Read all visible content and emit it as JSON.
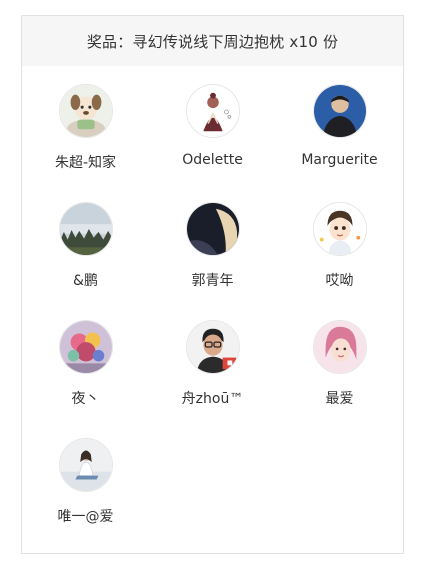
{
  "prize": {
    "label": "奖品：寻幻传说线下周边抱枕 x10 份"
  },
  "winners": [
    {
      "name": "朱超-知家",
      "avatar": "cartoon-dog-avatar"
    },
    {
      "name": "Odelette",
      "avatar": "sketch-girl-avatar"
    },
    {
      "name": "Marguerite",
      "avatar": "man-photo-avatar"
    },
    {
      "name": "&鹏",
      "avatar": "landscape-avatar"
    },
    {
      "name": "郭青年",
      "avatar": "dark-photo-avatar"
    },
    {
      "name": "哎呦",
      "avatar": "cartoon-boy-avatar"
    },
    {
      "name": "夜丶",
      "avatar": "colorful-photo-avatar"
    },
    {
      "name": "舟zhoū™",
      "avatar": "man-with-glasses-avatar"
    },
    {
      "name": "最爱",
      "avatar": "pink-portrait-avatar"
    },
    {
      "name": "唯一@爱",
      "avatar": "girl-sitting-avatar"
    }
  ]
}
